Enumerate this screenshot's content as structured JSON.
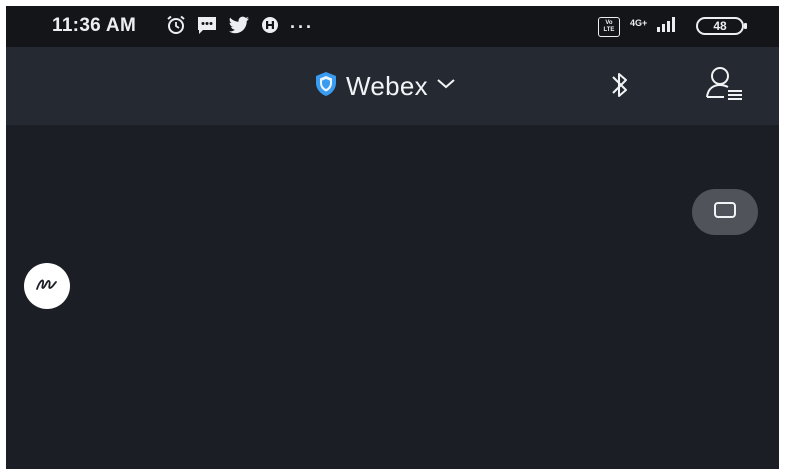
{
  "status_bar": {
    "time": "11:36 AM",
    "overflow": "···",
    "network_label": "4G+",
    "volte_label": "Vo LTE",
    "battery": "48",
    "icons": [
      "alarm-icon",
      "message-icon",
      "twitter-icon",
      "app-icon",
      "volte-icon",
      "signal-icon",
      "battery-icon"
    ]
  },
  "header": {
    "title": "Webex",
    "icons": [
      "shield-icon",
      "chevron-down-icon",
      "bluetooth-icon",
      "user-list-icon"
    ]
  },
  "canvas": {
    "left_button_icon": "scribble-icon",
    "right_button_icon": "rectangle-icon"
  },
  "colors": {
    "status_bar_bg": "#131519",
    "header_bg": "#252a32",
    "canvas_bg": "#1b1e24",
    "shield_blue": "#3a9cf0",
    "grey_button": "#50535a"
  }
}
